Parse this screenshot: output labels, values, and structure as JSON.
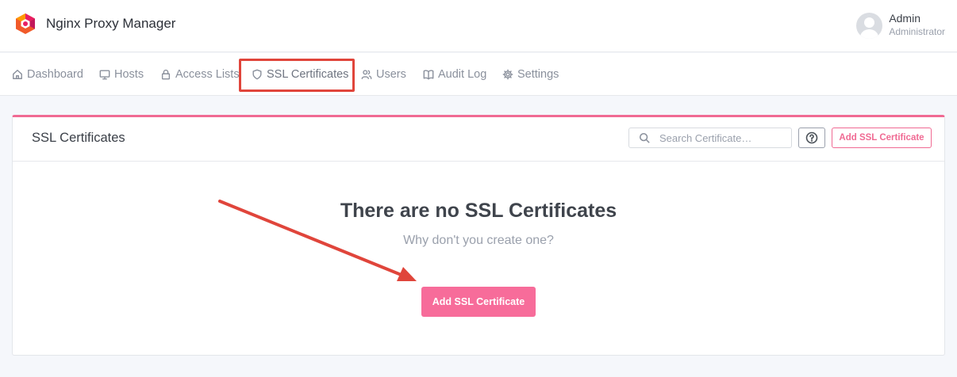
{
  "app": {
    "title": "Nginx Proxy Manager"
  },
  "user": {
    "name": "Admin",
    "role": "Administrator"
  },
  "nav": {
    "items": [
      {
        "label": "Dashboard",
        "icon": "home-icon"
      },
      {
        "label": "Hosts",
        "icon": "monitor-icon"
      },
      {
        "label": "Access Lists",
        "icon": "lock-icon"
      },
      {
        "label": "SSL Certificates",
        "icon": "shield-icon",
        "active": true
      },
      {
        "label": "Users",
        "icon": "users-icon"
      },
      {
        "label": "Audit Log",
        "icon": "book-icon"
      },
      {
        "label": "Settings",
        "icon": "gear-icon"
      }
    ]
  },
  "card": {
    "title": "SSL Certificates",
    "search_placeholder": "Search Certificate…",
    "add_button_label": "Add SSL Certificate",
    "empty_title": "There are no SSL Certificates",
    "empty_subtitle": "Why don't you create one?",
    "empty_add_button_label": "Add SSL Certificate"
  },
  "colors": {
    "accent": "#f06a93",
    "annotation": "#e0453b"
  }
}
